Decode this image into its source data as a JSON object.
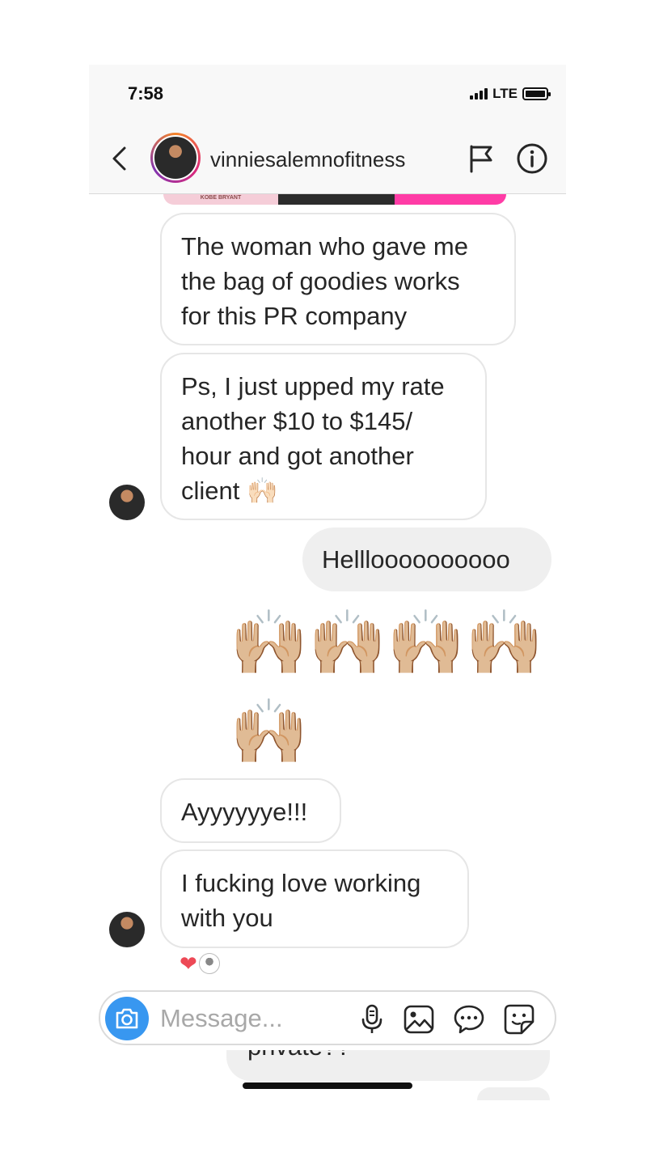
{
  "status_bar": {
    "time": "7:58",
    "network": "LTE"
  },
  "header": {
    "username": "vinniesalemnofitness"
  },
  "shared_post": {
    "caption_fragment": "KOBE BRYANT"
  },
  "messages": [
    {
      "from": "them",
      "text": "The woman who gave me the bag of goodies works for this PR company"
    },
    {
      "from": "them",
      "text": "Ps, I just upped my rate another $10 to $145/ hour and got another client 🙌🏻"
    },
    {
      "from": "me",
      "text": "Hellloooooooooo"
    },
    {
      "from": "me",
      "emoji_row_1": "🙌🏼🙌🏼🙌🏼🙌🏼",
      "emoji_row_2": "🙌🏼"
    },
    {
      "from": "them",
      "text": "Ayyyyyye!!!"
    },
    {
      "from": "them",
      "text": "I fucking love working with you"
    }
  ],
  "reaction": {
    "emoji": "❤"
  },
  "composer": {
    "placeholder": "Message..."
  },
  "peek": {
    "text": "private??"
  },
  "colors": {
    "accent": "#3897f0",
    "heart": "#ed4956",
    "bubble_out": "#efefef"
  }
}
